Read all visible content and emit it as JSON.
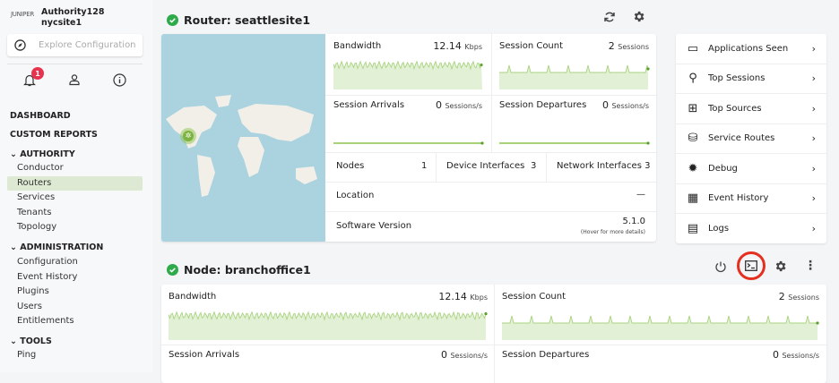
{
  "sidebar": {
    "logo": "JUNIPER",
    "authority": "Authority128",
    "site": "nycsite1",
    "explore_placeholder": "Explore Configuration",
    "notification_count": "1",
    "nav": {
      "dashboard": "DASHBOARD",
      "custom_reports": "CUSTOM REPORTS",
      "authority": "AUTHORITY",
      "authority_items": [
        "Conductor",
        "Routers",
        "Services",
        "Tenants",
        "Topology"
      ],
      "administration": "ADMINISTRATION",
      "admin_items": [
        "Configuration",
        "Event History",
        "Plugins",
        "Users",
        "Entitlements"
      ],
      "tools": "TOOLS",
      "tools_items": [
        "Ping"
      ]
    }
  },
  "router": {
    "title": "Router: seattlesite1",
    "bandwidth": {
      "label": "Bandwidth",
      "value": "12.14",
      "unit": "Kbps"
    },
    "session_count": {
      "label": "Session Count",
      "value": "2",
      "unit": "Sessions"
    },
    "arrivals": {
      "label": "Session Arrivals",
      "value": "0",
      "unit": "Sessions/s"
    },
    "departures": {
      "label": "Session Departures",
      "value": "0",
      "unit": "Sessions/s"
    },
    "nodes": {
      "label": "Nodes",
      "value": "1"
    },
    "device_interfaces": {
      "label": "Device Interfaces",
      "value": "3"
    },
    "network_interfaces": {
      "label": "Network Interfaces",
      "value": "3"
    },
    "location": {
      "label": "Location",
      "value": "—"
    },
    "software": {
      "label": "Software Version",
      "value": "5.1.0",
      "hint": "(Hover for more details)"
    }
  },
  "menu": [
    "Applications Seen",
    "Top Sessions",
    "Top Sources",
    "Service Routes",
    "Debug",
    "Event History",
    "Logs"
  ],
  "node": {
    "title": "Node: branchoffice1",
    "bandwidth": {
      "label": "Bandwidth",
      "value": "12.14",
      "unit": "Kbps"
    },
    "session_count": {
      "label": "Session Count",
      "value": "2",
      "unit": "Sessions"
    },
    "arrivals": {
      "label": "Session Arrivals",
      "value": "0",
      "unit": "Sessions/s"
    },
    "departures": {
      "label": "Session Departures",
      "value": "0",
      "unit": "Sessions/s"
    }
  },
  "colors": {
    "accent": "#8bc34a",
    "fill": "#e2f0d6",
    "highlight": "#e53020",
    "selected": "#dde9d3"
  }
}
